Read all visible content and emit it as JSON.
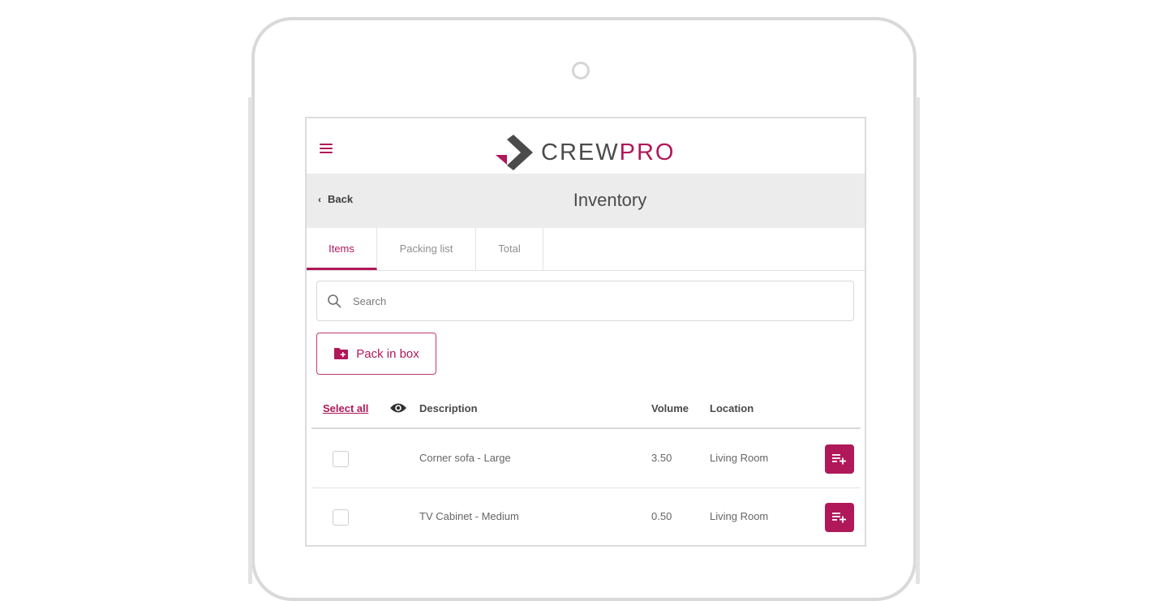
{
  "brand": {
    "name_part1": "CREW",
    "name_part2": "PRO",
    "accent_color": "#b0185a",
    "dark_color": "#4b4b4b"
  },
  "header": {
    "menu_icon": "hamburger-icon",
    "back_label": "Back",
    "title": "Inventory"
  },
  "tabs": [
    {
      "label": "Items",
      "active": true
    },
    {
      "label": "Packing list",
      "active": false
    },
    {
      "label": "Total",
      "active": false
    }
  ],
  "search": {
    "placeholder": "Search",
    "value": ""
  },
  "actions": {
    "pack_in_box_label": "Pack in box"
  },
  "table": {
    "select_all_label": "Select all",
    "columns": [
      "Description",
      "Volume",
      "Location"
    ],
    "rows": [
      {
        "description": "Corner sofa - Large",
        "volume": "3.50",
        "location": "Living Room",
        "checked": false
      },
      {
        "description": "TV Cabinet - Medium",
        "volume": "0.50",
        "location": "Living Room",
        "checked": false
      }
    ]
  }
}
